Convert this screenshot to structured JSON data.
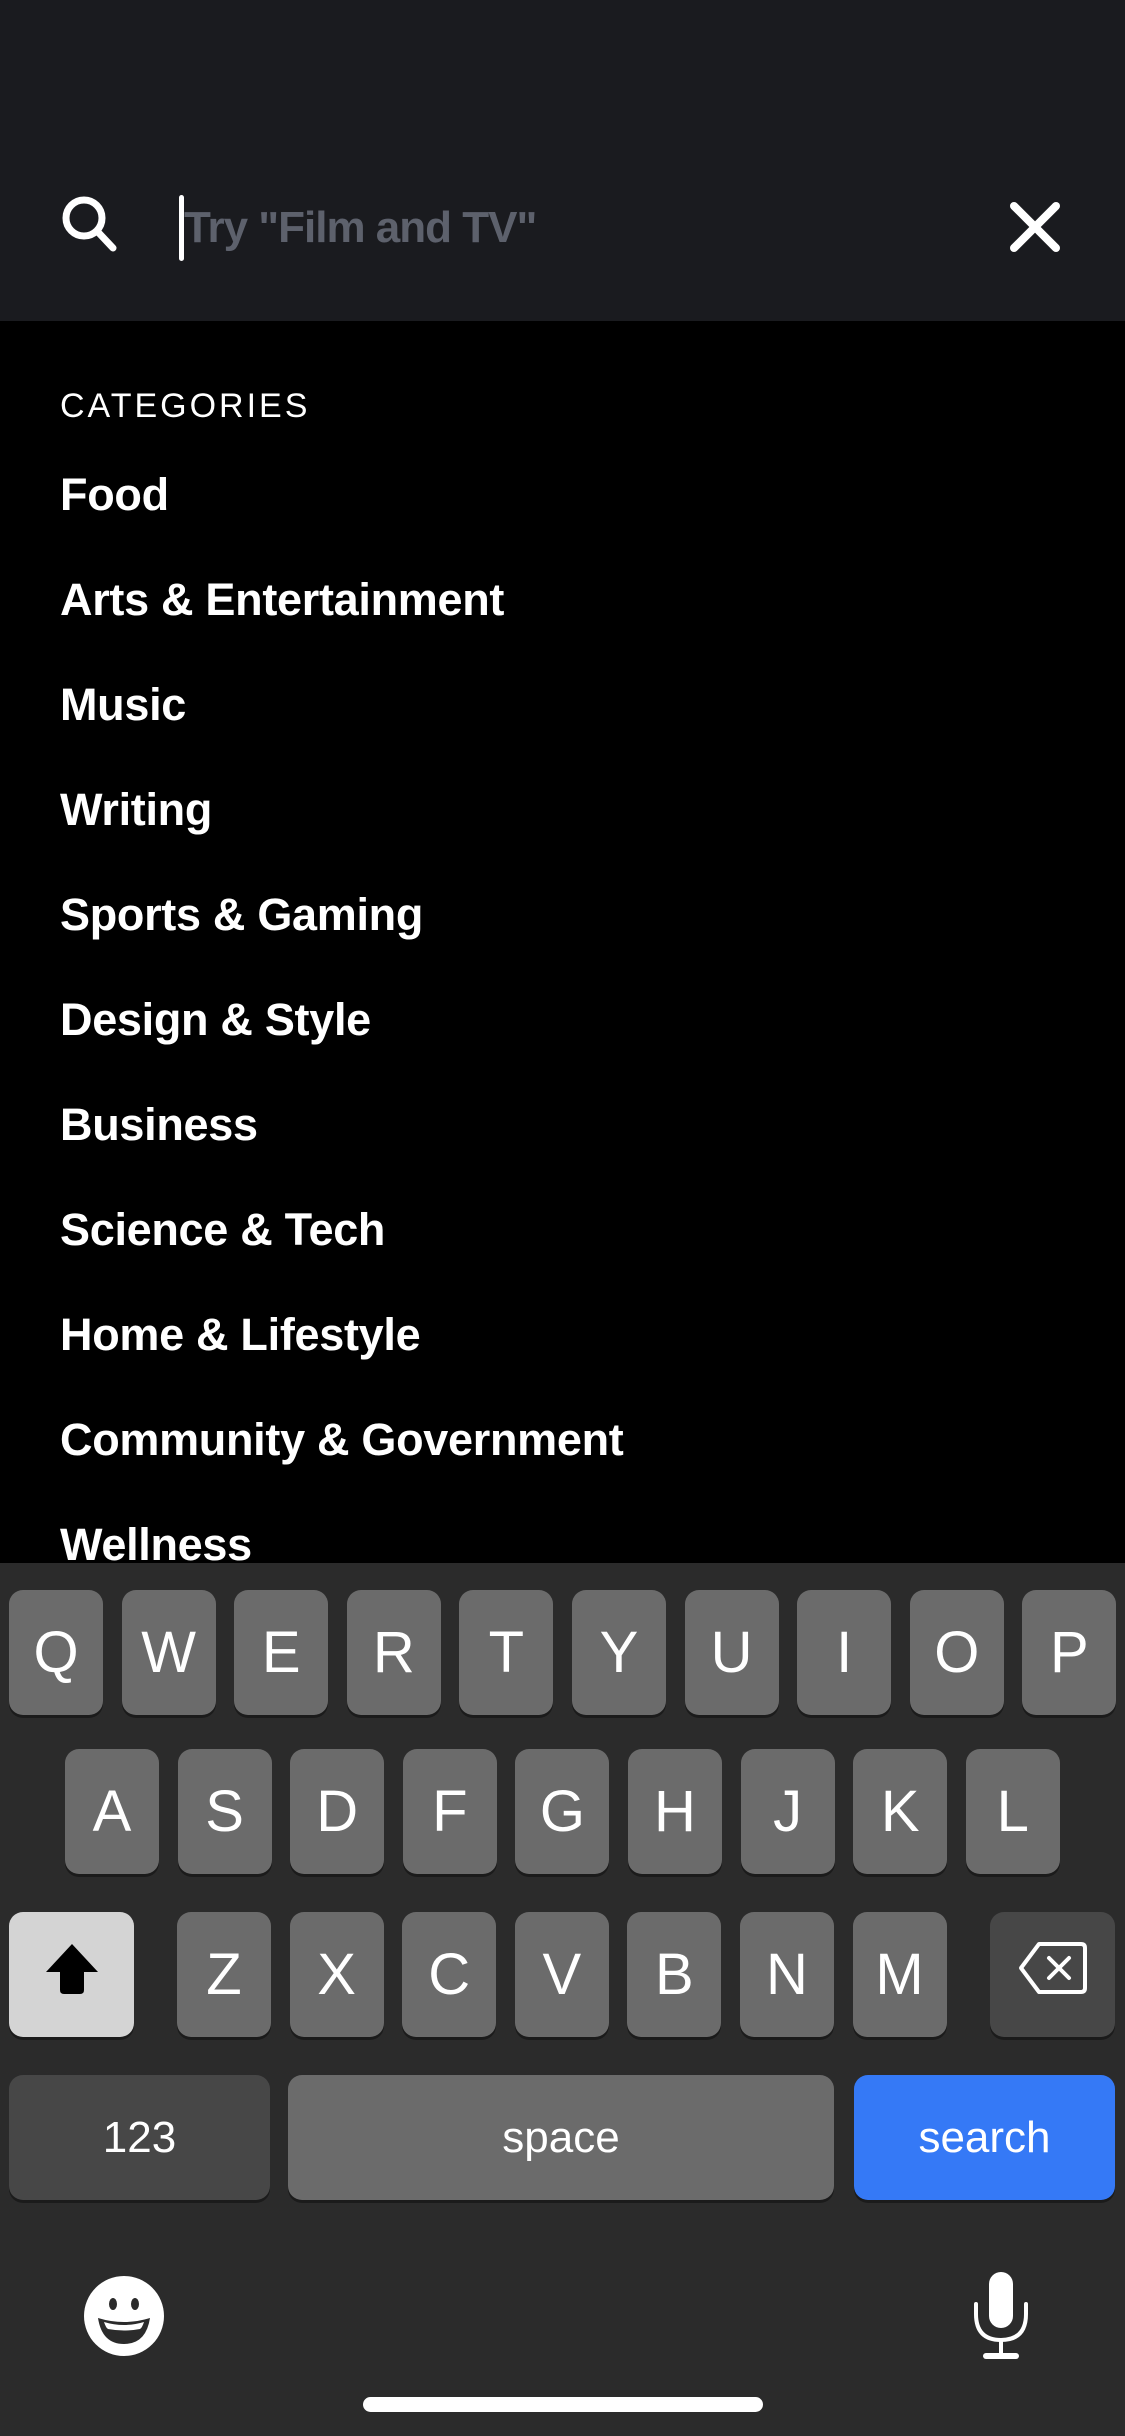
{
  "search": {
    "placeholder": "Try \"Film and TV\"",
    "value": ""
  },
  "icons": {
    "search": "search-icon",
    "close": "close-icon",
    "shift": "shift-arrow-icon",
    "backspace": "backspace-icon",
    "emoji": "emoji-icon",
    "microphone": "microphone-icon"
  },
  "categories": {
    "heading": "CATEGORIES",
    "items": [
      "Food",
      "Arts & Entertainment",
      "Music",
      "Writing",
      "Sports & Gaming",
      "Design & Style",
      "Business",
      "Science & Tech",
      "Home & Lifestyle",
      "Community & Government",
      "Wellness"
    ]
  },
  "keyboard": {
    "row1": [
      "Q",
      "W",
      "E",
      "R",
      "T",
      "Y",
      "U",
      "I",
      "O",
      "P"
    ],
    "row2": [
      "A",
      "S",
      "D",
      "F",
      "G",
      "H",
      "J",
      "K",
      "L"
    ],
    "row3": [
      "Z",
      "X",
      "C",
      "V",
      "B",
      "N",
      "M"
    ],
    "numbers_label": "123",
    "space_label": "space",
    "return_label": "search"
  },
  "colors": {
    "header_bg": "#1a1b1f",
    "content_bg": "#000000",
    "keyboard_bg": "#2b2b2b",
    "key_bg": "#6b6b6b",
    "key_dark_bg": "#474747",
    "accent_blue": "#3579f6",
    "placeholder": "#5d616c"
  }
}
